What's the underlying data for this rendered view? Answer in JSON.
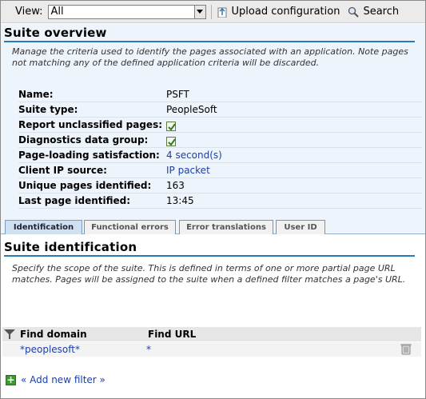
{
  "toolbar": {
    "view_label": "View:",
    "view_value": "All",
    "upload_label": "Upload configuration",
    "search_label": "Search"
  },
  "overview": {
    "title": "Suite overview",
    "description": "Manage the criteria used to identify the pages associated with an application. Note pages not matching any of the defined application criteria will be discarded.",
    "properties": [
      {
        "label": "Name:",
        "value": "PSFT"
      },
      {
        "label": "Suite type:",
        "value": "PeopleSoft"
      },
      {
        "label": "Report unclassified pages:",
        "checked": true
      },
      {
        "label": "Diagnostics data group:",
        "checked": true
      },
      {
        "label": "Page-loading satisfaction:",
        "value": "4 second(s)"
      },
      {
        "label": "Client IP source:",
        "value": "IP packet"
      },
      {
        "label": "Unique pages identified:",
        "value": "163"
      },
      {
        "label": "Last page identified:",
        "value": "13:45"
      }
    ]
  },
  "tabs": [
    "Identification",
    "Functional errors",
    "Error translations",
    "User ID"
  ],
  "identification": {
    "title": "Suite identification",
    "description": "Specify the scope of the suite. This is defined in terms of one or more partial page URL matches. Pages will be assigned to the suite when a defined filter matches a page's URL.",
    "columns": [
      "Find domain",
      "Find URL"
    ],
    "filters": [
      {
        "domain": "*peoplesoft*",
        "url": "*"
      }
    ],
    "add_filter_label": "« Add new filter »"
  },
  "colors": {
    "accent": "#2a7ab5",
    "link": "#1c3fa8",
    "panel_bg": "#eef4fb"
  }
}
